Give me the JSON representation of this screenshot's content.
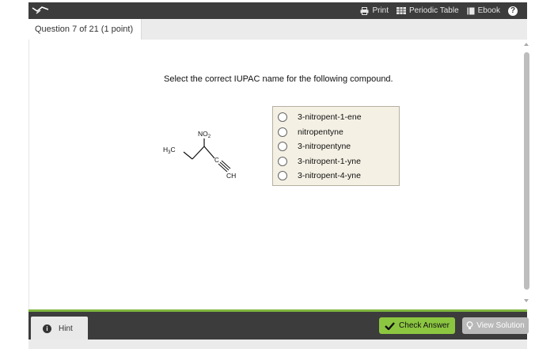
{
  "toolbar": {
    "print_label": "Print",
    "periodic_table_label": "Periodic Table",
    "ebook_label": "Ebook",
    "help_label": "?"
  },
  "question": {
    "header": "Question 7 of 21 (1 point)",
    "prompt": "Select the correct IUPAC name for the following compound."
  },
  "molecule": {
    "labels": {
      "methyl": "H3C",
      "nitro": "NO2",
      "carbon": "C",
      "terminal": "CH"
    }
  },
  "choices": [
    {
      "label": "3-nitropent-1-ene",
      "selected": false
    },
    {
      "label": "nitropentyne",
      "selected": false
    },
    {
      "label": "3-nitropentyne",
      "selected": false
    },
    {
      "label": "3-nitropent-1-yne",
      "selected": false
    },
    {
      "label": "3-nitropent-4-yne",
      "selected": false
    }
  ],
  "footer": {
    "hint_label": "Hint",
    "hint_icon": "i",
    "check_label": "Check Answer",
    "view_solution_label": "View Solution"
  },
  "colors": {
    "topbar": "#3c3c3c",
    "accent_green": "#8cc641",
    "choice_bg": "#f4f0e4"
  }
}
